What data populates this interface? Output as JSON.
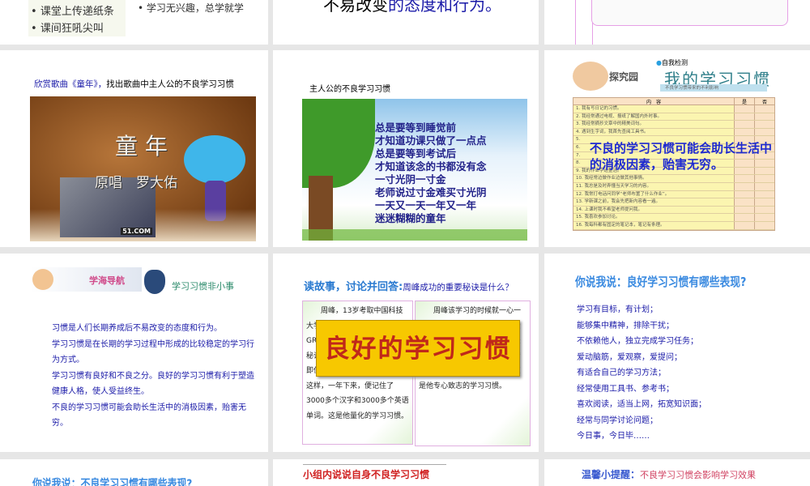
{
  "row1": {
    "s1": {
      "bullets": [
        "课堂上传递纸条",
        "课间狂吼尖叫"
      ],
      "side_bullet": "学习无兴趣，总学就学"
    },
    "s2": {
      "text_black": "不易改变",
      "text_blue": "的态度和行为。"
    }
  },
  "row2": {
    "s1": {
      "title_blue": "欣赏歌曲《童年》，",
      "title_black": "找出歌曲中主人公的不良学习习惯",
      "video_title": "童 年",
      "video_singer": "原唱　罗大佑",
      "watermark": "51.COM"
    },
    "s2": {
      "title": "主人公的不良学习习惯",
      "lyrics": [
        "总是要等到睡觉前",
        "才知道功课只做了一点点",
        "总是要等到考试后",
        "才知道该念的书都没有念",
        "一寸光阴一寸金",
        "老师说过寸金难买寸光阴",
        "一天又一天一年又一年",
        "迷迷糊糊的童年"
      ]
    },
    "s3": {
      "section": "探究园",
      "tag": "自我检测",
      "title": "我的学习习惯",
      "subtitle": "不良学习惯带来的不利影响",
      "table_headers": [
        "内　容",
        "是",
        "否"
      ],
      "rows": [
        "1. 我有写日记的习惯。",
        "2. 我经常通过电视、报纸了解国内外时事。",
        "3. 我经常摘抄文章中的精美词句。",
        "4. 遇到生字词，我首先查阅工具书。",
        "5.",
        "6.",
        "7.",
        "8.",
        "9. 我的作业字迹整洁。",
        "10. 我经常边做作业边做其他事情。",
        "11. 我总是及时弄懂当天学习的内容。",
        "12. 我常打电话问同学“老师布置了什么作业”。",
        "13. 学新课之前，我会先把新内容看一遍。",
        "14. 上课时我不希望老师提问我。",
        "15. 我喜欢参加讨论。",
        "16. 我每科都有固定的笔记本，笔记有条理。"
      ],
      "overlay": "不良的学习习惯可能会助长生活中的消极因素，贻害无穷。"
    }
  },
  "row3": {
    "s1": {
      "nav": "学海导航",
      "heading": "学习习惯非小事",
      "paragraphs": [
        "习惯是人们长期养成后不易改变的态度和行为。",
        "学习习惯是在长期的学习过程中形成的比较稳定的学习行为方式。",
        "学习习惯有良好和不良之分。良好的学习习惯有利于塑造健康人格，使人受益终生。",
        "不良的学习习惯可能会助长生活中的消极因素，贻害无穷。"
      ]
    },
    "s2": {
      "title_a": "读故事，讨论并回答:",
      "title_b": "周峰成功的重要秘诀是什么？",
      "left_story": "周峰，13岁考取中国科技大学少年班，20岁时以托福和GRE的优异成绩得……而赴……秘诀……周峰……每天10个，即使是亲访友时也从不间断。就这样，一年下来，便记住了3000多个汉字和3000多个英语单词。这是他量化的学习习惯。",
      "right_story": "周峰该学习的时候就一心一意学习，该玩儿的时候就轻轻松松地玩儿。……周峰学习时总是全神贯注，思想从不开小差，精神略有溜号便立即做出调整。这是他专心致志的学习习惯。",
      "banner": "良好的学习习惯"
    },
    "s3": {
      "title": "你说我说：良好学习习惯有哪些表现?",
      "items": [
        "学习有目标，有计划；",
        "能够集中精神，排除干扰；",
        "不依赖他人，独立完成学习任务；",
        "爱动脑筋，爱观察，爱提问；",
        "有适合自己的学习方法；",
        "经常使用工具书、参考书；",
        "喜欢阅读，适当上网，拓宽知识面；",
        "经常与同学讨论问题；",
        "今日事，今日毕……"
      ]
    }
  },
  "row4": {
    "s1": {
      "title": "你说我说：不良学习习惯有哪些表现?"
    },
    "s2": {
      "title": "小组内说说自身不良学习习惯"
    },
    "s3": {
      "tag": "温馨小提醒：",
      "text": "不良学习习惯会影响学习效果"
    }
  },
  "colors": {
    "bg": "#e6e6e6",
    "blue_text": "#1a1aa8",
    "banner_yellow": "#f7c800",
    "banner_red": "#c0281a"
  }
}
